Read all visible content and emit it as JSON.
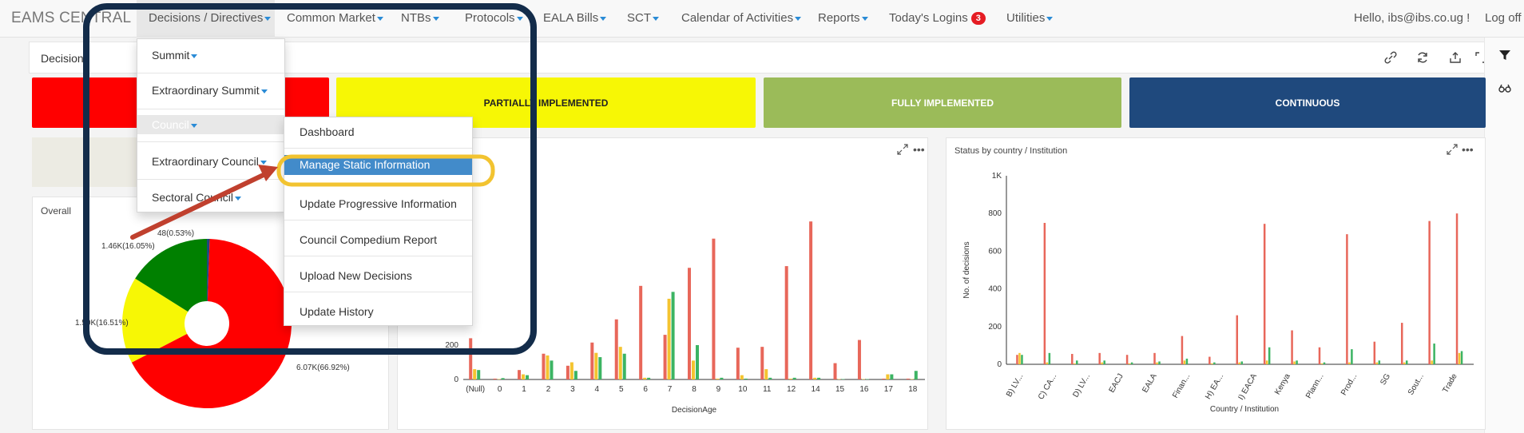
{
  "brand": "EAMS CENTRAL",
  "nav": {
    "items": [
      {
        "label": "Decisions / Directives",
        "caret": true
      },
      {
        "label": "Common Market",
        "caret": true
      },
      {
        "label": "NTBs",
        "caret": true
      },
      {
        "label": "Protocols",
        "caret": true
      },
      {
        "label": "EALA Bills",
        "caret": true
      },
      {
        "label": "SCT",
        "caret": true
      },
      {
        "label": "Calendar of Activities",
        "caret": true
      },
      {
        "label": "Reports",
        "caret": true
      },
      {
        "label": "Today's Logins",
        "badge": "3"
      },
      {
        "label": "Utilities",
        "caret": true
      }
    ],
    "greeting": "Hello, ibs@ibs.co.ug !",
    "logoff": "Log off"
  },
  "subbar": {
    "title": "Decision"
  },
  "tiles": [
    {
      "label": "",
      "color": "#ff0000"
    },
    {
      "label": "PARTIALLY IMPLEMENTED",
      "color": "#f7f705"
    },
    {
      "label": "FULLY IMPLEMENTED",
      "color": "#9bbb59"
    },
    {
      "label": "CONTINUOUS",
      "color": "#1f497d"
    }
  ],
  "menu": {
    "items": [
      "Summit",
      "Extraordinary Summit",
      "Council",
      "Extraordinary Council",
      "Sectoral Council"
    ],
    "submenu": [
      "Dashboard",
      "Manage Static Information",
      "Update Progressive Information",
      "Council Compedium Report",
      "Upload New Decisions",
      "Update History"
    ],
    "highlighted": "Manage Static Information"
  },
  "panels": {
    "overall_title": "Overall",
    "country_title": "Status by country / Institution"
  },
  "chart_data": [
    {
      "type": "pie",
      "title": "Overall",
      "labels": [
        "6.07K(66.92%)",
        "1.50K(16.51%)",
        "1.46K(16.05%)",
        "48(0.53%)"
      ],
      "values": [
        6070,
        1500,
        1460,
        48
      ],
      "colors": [
        "#ff0000",
        "#f7f705",
        "#008000",
        "#1f497d"
      ]
    },
    {
      "type": "bar",
      "xlabel": "DecisionAge",
      "categories": [
        "(Null)",
        "0",
        "1",
        "2",
        "3",
        "4",
        "5",
        "6",
        "7",
        "8",
        "9",
        "10",
        "11",
        "12",
        "14",
        "15",
        "16",
        "17",
        "18"
      ],
      "y_ticks": [
        0,
        200
      ],
      "series": [
        {
          "color": "#e8675a",
          "values": [
            240,
            5,
            55,
            150,
            80,
            215,
            350,
            545,
            260,
            650,
            820,
            185,
            190,
            660,
            920,
            95,
            230,
            5,
            5
          ]
        },
        {
          "color": "#f4c430",
          "values": [
            60,
            2,
            30,
            140,
            100,
            155,
            190,
            10,
            470,
            110,
            5,
            25,
            60,
            5,
            10,
            0,
            0,
            30,
            0
          ]
        },
        {
          "color": "#3cb463",
          "values": [
            55,
            8,
            25,
            110,
            50,
            130,
            150,
            10,
            510,
            200,
            10,
            5,
            10,
            10,
            10,
            0,
            0,
            30,
            50
          ]
        }
      ]
    },
    {
      "type": "bar",
      "title": "Status by country / Institution",
      "xlabel": "Country / Institution",
      "ylabel": "No. of decisions",
      "y_ticks": [
        "0",
        "200",
        "400",
        "600",
        "800",
        "1K"
      ],
      "ylim": [
        0,
        1000
      ],
      "categories": [
        "B) LV...",
        "C) CA...",
        "D) LV...",
        "EACJ",
        "EALA",
        "Finan...",
        "H) EA...",
        "I) EACA",
        "Kenya",
        "Plann...",
        "Prod...",
        "SG",
        "Sout...",
        "Trade"
      ],
      "series": [
        {
          "color": "#e8675a",
          "values": [
            50,
            750,
            55,
            60,
            50,
            60,
            150,
            40,
            260,
            745,
            180,
            90,
            690,
            120,
            220,
            760,
            800
          ]
        },
        {
          "color": "#f4c430",
          "values": [
            60,
            10,
            5,
            10,
            5,
            10,
            20,
            5,
            10,
            20,
            15,
            5,
            10,
            10,
            10,
            20,
            60
          ]
        },
        {
          "color": "#3cb463",
          "values": [
            50,
            60,
            20,
            20,
            10,
            15,
            30,
            10,
            15,
            90,
            20,
            10,
            80,
            20,
            20,
            110,
            70
          ]
        }
      ]
    }
  ]
}
